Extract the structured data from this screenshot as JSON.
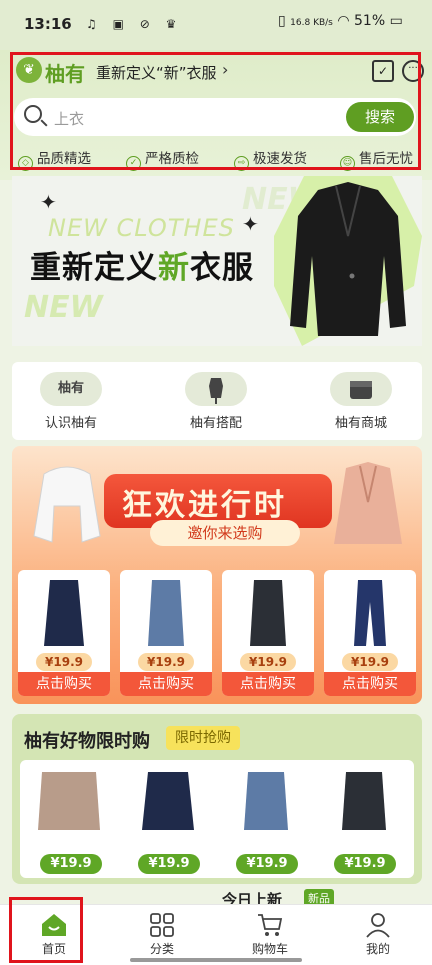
{
  "status_bar": {
    "time": "13:16",
    "net_speed": "16.8 KB/s",
    "battery": "51%"
  },
  "header": {
    "brand": "柚有",
    "slogan": "重新定义“新”衣服",
    "chevron": "›"
  },
  "search": {
    "placeholder": "上衣",
    "button_label": "搜索"
  },
  "features": [
    "品质精选",
    "严格质检",
    "极速发货",
    "售后无忧"
  ],
  "banner": {
    "en_text": "NEW CLOTHES",
    "title_pre": "重新定义",
    "title_hl": "新",
    "title_post": "衣服",
    "en_text2": "NEW",
    "en_text3": "NEW"
  },
  "nav": [
    {
      "icon_text": "柚有",
      "label": "认识柚有"
    },
    {
      "icon_text": "",
      "label": "柚有搭配"
    },
    {
      "icon_text": "",
      "label": "柚有商城"
    }
  ],
  "promo": {
    "title": "狂欢进行时",
    "subtitle": "邀你来选购",
    "items": [
      {
        "price": "¥19.9",
        "button": "点击购买"
      },
      {
        "price": "¥19.9",
        "button": "点击购买"
      },
      {
        "price": "¥19.9",
        "button": "点击购买"
      },
      {
        "price": "¥19.9",
        "button": "点击购买"
      }
    ]
  },
  "good": {
    "title": "柚有好物限时购",
    "tag": "限时抢购",
    "items": [
      {
        "price": "¥19.9"
      },
      {
        "price": "¥19.9"
      },
      {
        "price": "¥19.9"
      },
      {
        "price": "¥19.9"
      }
    ]
  },
  "next_section": {
    "title": "今日上新",
    "tag": "新品"
  },
  "tabbar": [
    {
      "label": "首页",
      "active": true
    },
    {
      "label": "分类",
      "active": false
    },
    {
      "label": "购物车",
      "active": false
    },
    {
      "label": "我的",
      "active": false
    }
  ],
  "colors": {
    "accent": "#5f9e22",
    "promo_red": "#f3573a",
    "highlight_box": "#e0141c"
  }
}
